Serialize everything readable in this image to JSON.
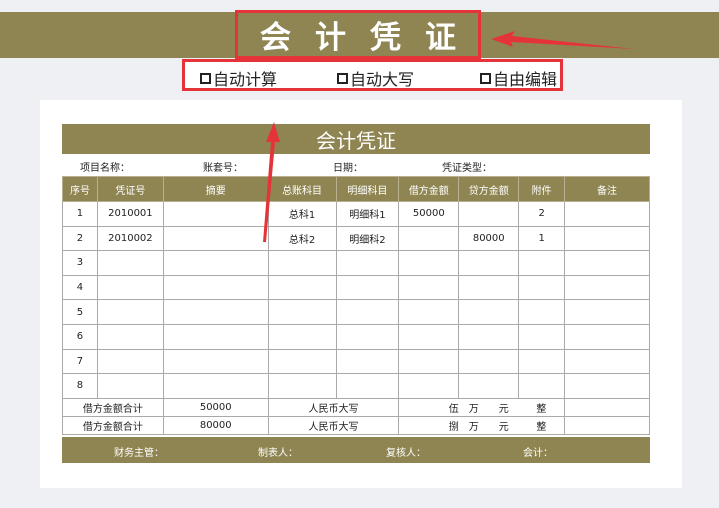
{
  "banner": {
    "title": "会计凭证"
  },
  "features": [
    {
      "label": "自动计算"
    },
    {
      "label": "自动大写"
    },
    {
      "label": "自由编辑"
    }
  ],
  "voucher": {
    "title": "会计凭证",
    "info": {
      "project_label": "项目名称：",
      "set_label": "账套号：",
      "date_label": "日期：",
      "type_label": "凭证类型："
    },
    "columns": [
      "序号",
      "凭证号",
      "摘要",
      "总账科目",
      "明细科目",
      "借方金额",
      "贷方金额",
      "附件",
      "备注"
    ],
    "rows": [
      {
        "seq": "1",
        "voucher_no": "2010001",
        "summary": "",
        "general": "总科1",
        "detail": "明细科1",
        "debit": "50000",
        "credit": "",
        "attach": "2",
        "remark": ""
      },
      {
        "seq": "2",
        "voucher_no": "2010002",
        "summary": "",
        "general": "总科2",
        "detail": "明细科2",
        "debit": "",
        "credit": "80000",
        "attach": "1",
        "remark": ""
      },
      {
        "seq": "3",
        "voucher_no": "",
        "summary": "",
        "general": "",
        "detail": "",
        "debit": "",
        "credit": "",
        "attach": "",
        "remark": ""
      },
      {
        "seq": "4",
        "voucher_no": "",
        "summary": "",
        "general": "",
        "detail": "",
        "debit": "",
        "credit": "",
        "attach": "",
        "remark": ""
      },
      {
        "seq": "5",
        "voucher_no": "",
        "summary": "",
        "general": "",
        "detail": "",
        "debit": "",
        "credit": "",
        "attach": "",
        "remark": ""
      },
      {
        "seq": "6",
        "voucher_no": "",
        "summary": "",
        "general": "",
        "detail": "",
        "debit": "",
        "credit": "",
        "attach": "",
        "remark": ""
      },
      {
        "seq": "7",
        "voucher_no": "",
        "summary": "",
        "general": "",
        "detail": "",
        "debit": "",
        "credit": "",
        "attach": "",
        "remark": ""
      },
      {
        "seq": "8",
        "voucher_no": "",
        "summary": "",
        "general": "",
        "detail": "",
        "debit": "",
        "credit": "",
        "attach": "",
        "remark": ""
      }
    ],
    "sums": [
      {
        "label": "借方金额合计",
        "amount": "50000",
        "rmb_label": "人民币大写",
        "d1": "伍",
        "d2": "万",
        "d3": "元",
        "d4": "整"
      },
      {
        "label": "借方金额合计",
        "amount": "80000",
        "rmb_label": "人民币大写",
        "d1": "捌",
        "d2": "万",
        "d3": "元",
        "d4": "整"
      }
    ],
    "footer": {
      "supervisor": "财务主管：",
      "maker": "制表人：",
      "reviewer": "复核人：",
      "accountant": "会计："
    }
  },
  "colors": {
    "header_bg": "#8f8552",
    "highlight": "#e4343a"
  }
}
